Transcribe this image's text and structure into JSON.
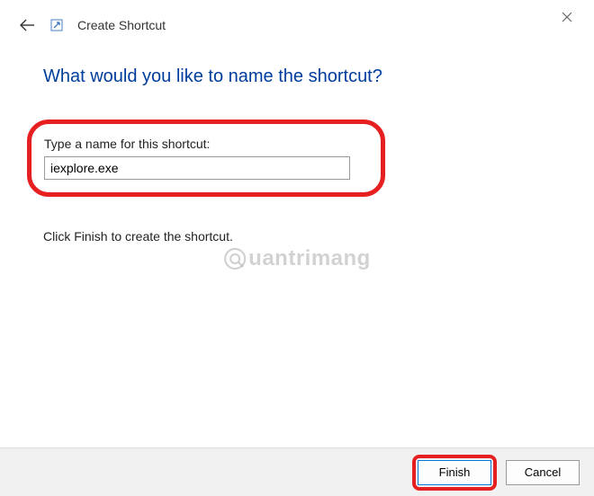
{
  "titlebar": {
    "title": "Create Shortcut"
  },
  "content": {
    "heading": "What would you like to name the shortcut?",
    "input_label": "Type a name for this shortcut:",
    "input_value": "iexplore.exe",
    "help_text": "Click Finish to create the shortcut."
  },
  "watermark": "uantrimang",
  "buttons": {
    "finish": "Finish",
    "cancel": "Cancel"
  }
}
